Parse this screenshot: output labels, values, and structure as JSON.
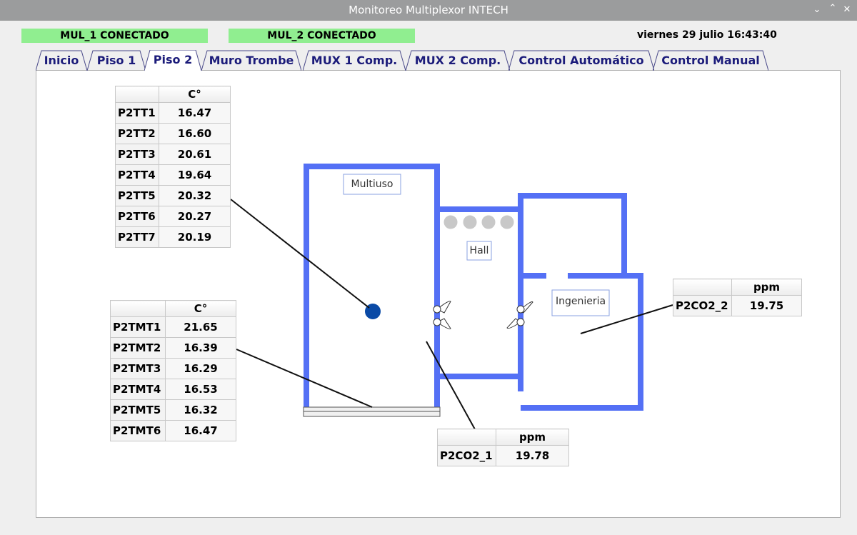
{
  "window": {
    "title": "Monitoreo Multiplexor INTECH"
  },
  "status": {
    "mul1": "MUL_1 CONECTADO",
    "mul2": "MUL_2 CONECTADO",
    "ok_color": "#90ee90"
  },
  "datetime": "viernes 29 julio 16:43:40",
  "tabs": [
    {
      "label": "Inicio"
    },
    {
      "label": "Piso 1"
    },
    {
      "label": "Piso 2"
    },
    {
      "label": "Muro Trombe"
    },
    {
      "label": "MUX 1 Comp."
    },
    {
      "label": "MUX 2 Comp."
    },
    {
      "label": "Control Automático"
    },
    {
      "label": "Control Manual"
    }
  ],
  "active_tab": "Piso 2",
  "tt_table": {
    "unit": "C°",
    "rows": [
      {
        "name": "P2TT1",
        "value": "16.47"
      },
      {
        "name": "P2TT2",
        "value": "16.60"
      },
      {
        "name": "P2TT3",
        "value": "20.61"
      },
      {
        "name": "P2TT4",
        "value": "19.64"
      },
      {
        "name": "P2TT5",
        "value": "20.32"
      },
      {
        "name": "P2TT6",
        "value": "20.27"
      },
      {
        "name": "P2TT7",
        "value": "20.19"
      }
    ]
  },
  "tmt_table": {
    "unit": "C°",
    "rows": [
      {
        "name": "P2TMT1",
        "value": "21.65"
      },
      {
        "name": "P2TMT2",
        "value": "16.39"
      },
      {
        "name": "P2TMT3",
        "value": "16.29"
      },
      {
        "name": "P2TMT4",
        "value": "16.53"
      },
      {
        "name": "P2TMT5",
        "value": "16.32"
      },
      {
        "name": "P2TMT6",
        "value": "16.47"
      }
    ]
  },
  "co2_1": {
    "unit": "ppm",
    "name": "P2CO2_1",
    "value": "19.78"
  },
  "co2_2": {
    "unit": "ppm",
    "name": "P2CO2_2",
    "value": "19.75"
  },
  "rooms": {
    "multiuso": "Multiuso",
    "hall": "Hall",
    "ingenieria": "Ingenieria"
  },
  "colors": {
    "wall": "#5470f5",
    "sensor": "#0a4aa6",
    "tab_text": "#1b1b7a"
  }
}
